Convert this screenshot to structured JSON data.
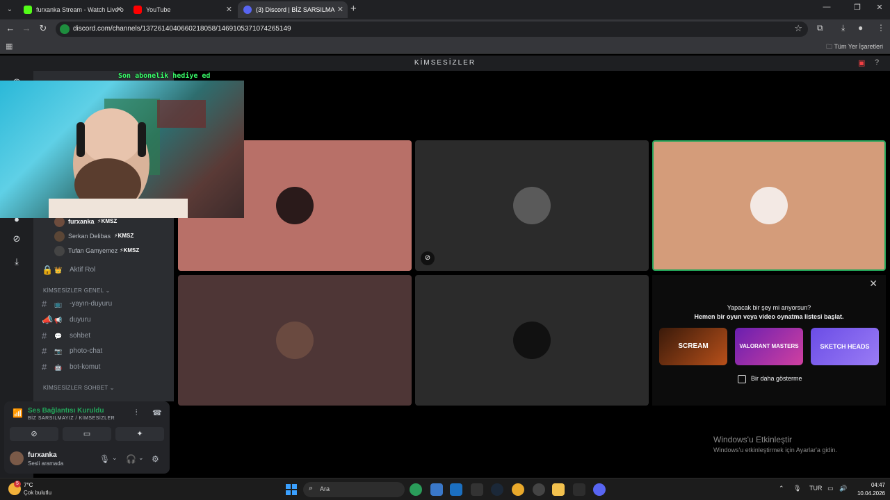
{
  "browser": {
    "tabs": [
      {
        "title": "furxanka Stream - Watch Live o",
        "color": "#53fc18"
      },
      {
        "title": "YouTube",
        "color": "#ff0000"
      },
      {
        "title": "(3) Discord | BİZ SARSILMA",
        "color": "#5865f2"
      }
    ],
    "url": "discord.com/channels/1372614040660218058/1469105371074265149",
    "bookmarks_label": "Tüm Yer İşaretleri"
  },
  "discord": {
    "server_title": "KİMSESİZLER",
    "voice_users": [
      {
        "name": "furxanka",
        "tag": "⚡KMSZ"
      },
      {
        "name": "Serkan Delibas",
        "tag": "⚡KMSZ"
      },
      {
        "name": "Tufan Gamyemez",
        "tag": "⚡KMSZ"
      }
    ],
    "role_channel": {
      "emoji": "👑",
      "name": "Aktif Rol"
    },
    "category_general": "KİMSESİZLER GENEL",
    "channels": [
      {
        "emoji": "📺",
        "name": "-yayın-duyuru"
      },
      {
        "emoji": "📢",
        "name": "duyuru"
      },
      {
        "emoji": "💬",
        "name": "sohbet"
      },
      {
        "emoji": "📷",
        "name": "photo-chat"
      },
      {
        "emoji": "🤖",
        "name": "bot-komut"
      }
    ],
    "category_chat": "KİMSESİZLER SOHBET",
    "voice_panel": {
      "status": "Ses Bağlantısı Kuruldu",
      "sub": "BİZ SARSILMAYIZ / KİMSESİZLER",
      "user": "furxanka",
      "user_status": "Sesli aramada"
    },
    "activity": {
      "title": "Yapacak bir şey mi arıyorsun?",
      "subtitle": "Hemen bir oyun veya video oynatma listesi başlat.",
      "games": [
        "SCREAM",
        "VALORANT MASTERS",
        "SKETCH HEADS"
      ],
      "checkbox_label": "Bir daha gösterme"
    },
    "tile_colors": [
      "#b87068",
      "#2b2b2b",
      "#d49c7a",
      "#4e3636",
      "#2b2b2b"
    ]
  },
  "overlay_text": "Son abonelik hediye ed",
  "windows_watermark": {
    "line1": "Windows'u Etkinleştir",
    "line2": "Windows'u etkinleştirmek için Ayarlar'a gidin."
  },
  "taskbar": {
    "weather_temp": "7°C",
    "weather_desc": "Çok bulutlu",
    "weather_badge": "5",
    "search_label": "Ara",
    "lang": "TUR",
    "time": "04:47",
    "date": "10.04.2026"
  }
}
